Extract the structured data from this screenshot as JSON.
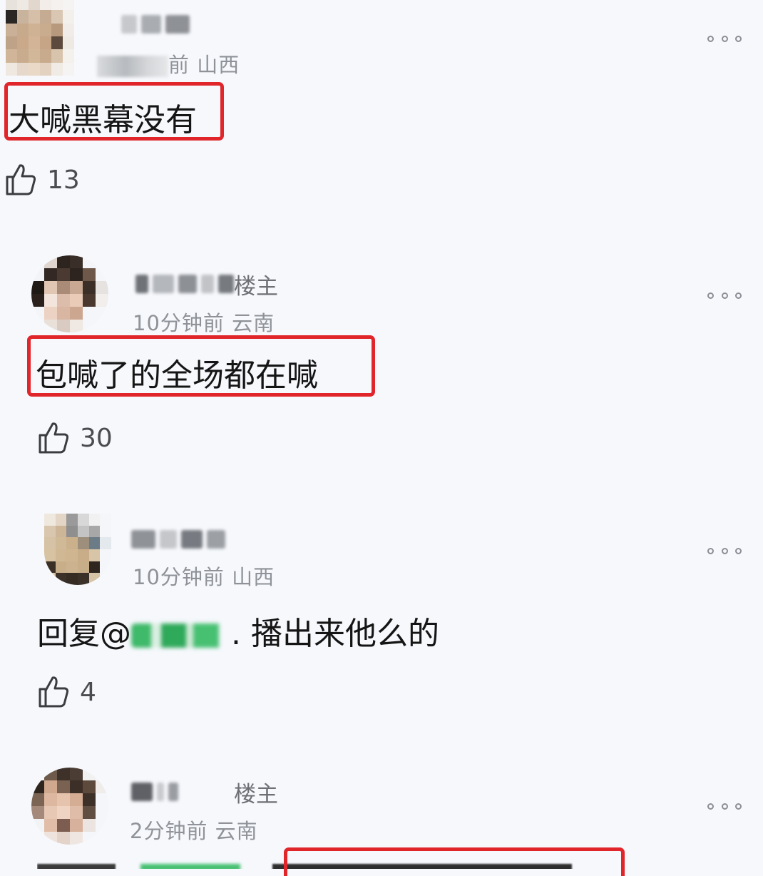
{
  "comments": [
    {
      "meta_suffix": "前 山西",
      "text": "大喊黑幕没有",
      "likes": "13",
      "highlighted": true
    },
    {
      "badge": "楼主",
      "meta": "10分钟前 云南",
      "text": "包喊了的全场都在喊",
      "likes": "30",
      "highlighted": true
    },
    {
      "meta": "10分钟前 山西",
      "reply_prefix": "回复@",
      "reply_text": ". 播出来他么的",
      "likes": "4",
      "highlighted": false
    },
    {
      "badge": "楼主",
      "meta": "2分钟前 云南",
      "highlighted": true
    }
  ],
  "icons": {
    "like": "thumbs-up-icon",
    "more": "more-options-icon"
  },
  "colors": {
    "highlight": "#e0262b",
    "background": "#f6f8fc",
    "meta": "#8f9298"
  }
}
